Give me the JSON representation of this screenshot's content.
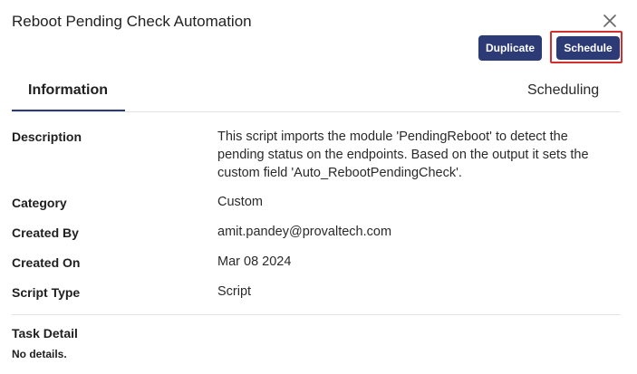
{
  "dialog": {
    "title": "Reboot Pending Check Automation",
    "close_icon": "close-icon"
  },
  "toolbar": {
    "duplicate_label": "Duplicate",
    "schedule_label": "Schedule"
  },
  "tabs": [
    {
      "label": "Information",
      "active": true
    },
    {
      "label": "Scheduling",
      "active": false
    }
  ],
  "details": {
    "description_label": "Description",
    "description_value": "This script imports the module 'PendingReboot' to detect the pending status on the endpoints. Based on the output it sets the custom field 'Auto_RebootPendingCheck'.",
    "category_label": "Category",
    "category_value": "Custom",
    "created_by_label": "Created By",
    "created_by_value": "amit.pandey@provaltech.com",
    "created_on_label": "Created On",
    "created_on_value": "Mar 08 2024",
    "script_type_label": "Script Type",
    "script_type_value": "Script"
  },
  "task_detail": {
    "title": "Task Detail",
    "body": "No details."
  },
  "colors": {
    "primary": "#2c3b75",
    "highlight": "#d32f2f"
  }
}
